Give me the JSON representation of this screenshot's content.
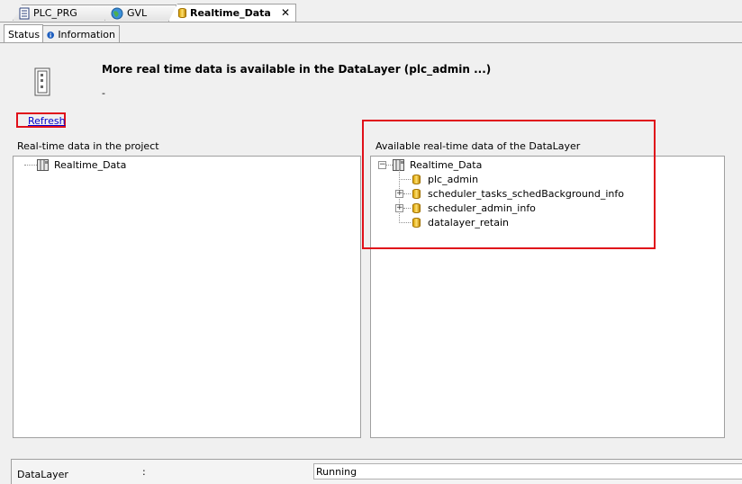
{
  "doc_tabs": [
    {
      "label": "PLC_PRG",
      "icon": "document-icon"
    },
    {
      "label": "GVL",
      "icon": "globe-icon"
    },
    {
      "label": "Realtime_Data",
      "icon": "database-icon",
      "active": true,
      "close": "✕"
    }
  ],
  "sub_tabs": [
    {
      "label": "Status",
      "active": true
    },
    {
      "label": "Information",
      "icon": "info-icon"
    }
  ],
  "header": {
    "message": "More real time data is available in the DataLayer (plc_admin ...)",
    "sub_message": "-",
    "refresh_link": "Refresh"
  },
  "left_panel": {
    "title": "Real-time data in the project",
    "items": [
      {
        "label": "Realtime_Data"
      }
    ]
  },
  "right_panel": {
    "title": "Available real-time data of the DataLayer",
    "root": "Realtime_Data",
    "items": [
      {
        "label": "plc_admin",
        "expandable": false
      },
      {
        "label": "scheduler_tasks_schedBackground_info",
        "expandable": true
      },
      {
        "label": "scheduler_admin_info",
        "expandable": true
      },
      {
        "label": "datalayer_retain",
        "expandable": false
      }
    ]
  },
  "status": {
    "name": "DataLayer",
    "separator": ":",
    "value": "Running"
  },
  "colors": {
    "highlight": "#e0101a",
    "link": "#0000cc"
  }
}
